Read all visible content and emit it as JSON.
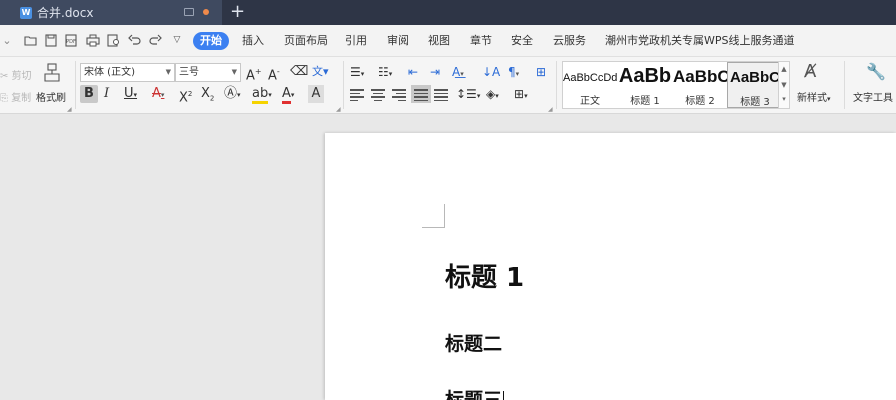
{
  "titlebar": {
    "doc_tab": {
      "icon": "W",
      "name": "合并.docx"
    },
    "new_tab": "+"
  },
  "menubar": {
    "quick_access": [
      "folder-open-icon",
      "save-icon",
      "export-pdf-icon",
      "print-icon",
      "print-preview-icon",
      "undo-icon",
      "redo-icon",
      "dropdown-icon"
    ],
    "items": [
      "开始",
      "插入",
      "页面布局",
      "引用",
      "审阅",
      "视图",
      "章节",
      "安全",
      "云服务",
      "潮州市党政机关专属WPS线上服务通道"
    ],
    "active": "开始"
  },
  "ribbon": {
    "clipboard": {
      "cut": "剪切",
      "copy": "复制",
      "format_painter": "格式刷"
    },
    "font": {
      "name": "宋体 (正文)",
      "size": "三号"
    },
    "styles": [
      {
        "sample": "AaBbCcDd",
        "name": "正文"
      },
      {
        "sample": "AaBb",
        "name": "标题 1"
      },
      {
        "sample": "AaBbC",
        "name": "标题 2"
      },
      {
        "sample": "AaBbC",
        "name": "标题 3"
      }
    ],
    "new_style": "新样式",
    "text_tools": "文字工具"
  },
  "document": {
    "heading1": "标题 1",
    "heading2": "标题二",
    "heading3": "标题三"
  },
  "colors": {
    "titlebar": "#2e3546",
    "accent": "#3c80f1",
    "highlight": "#f5d300",
    "font_color": "#e03030"
  }
}
